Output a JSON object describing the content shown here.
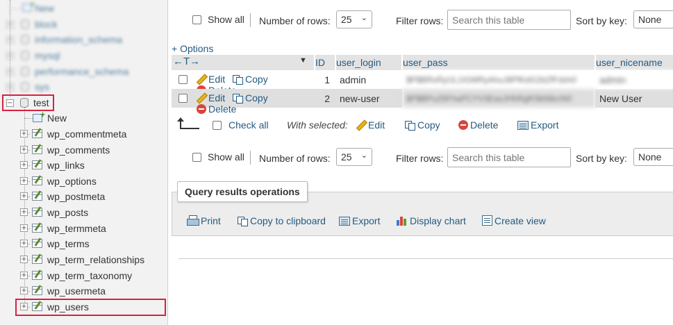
{
  "nav": {
    "blurred_items": [
      "New",
      "block",
      "information_schema",
      "mysql",
      "performance_schema",
      "sys"
    ],
    "database": "test",
    "new_label": "New",
    "tables": [
      "wp_commentmeta",
      "wp_comments",
      "wp_links",
      "wp_options",
      "wp_postmeta",
      "wp_posts",
      "wp_termmeta",
      "wp_terms",
      "wp_term_relationships",
      "wp_term_taxonomy",
      "wp_usermeta",
      "wp_users"
    ],
    "highlight_color": "#d6223f"
  },
  "controls": {
    "show_all": "Show all",
    "number_of_rows_label": "Number of rows:",
    "number_of_rows_value": "25",
    "filter_rows_label": "Filter rows:",
    "filter_placeholder": "Search this table",
    "sort_by_key_label": "Sort by key:",
    "sort_by_key_value": "None"
  },
  "options_link": "+ Options",
  "table": {
    "sort_arrows": "←T→",
    "headers": [
      "ID",
      "user_login",
      "user_pass",
      "user_nicename"
    ],
    "actions": {
      "edit": "Edit",
      "copy": "Copy",
      "delete": "Delete"
    },
    "rows": [
      {
        "id": "1",
        "user_login": "admin",
        "user_pass": "$P$BRxRyUL1IGMRyAhuJ8PfKdG2bZfFdsh0",
        "user_nicename": "admin"
      },
      {
        "id": "2",
        "user_login": "new-user",
        "user_pass": "$P$BPuZ6FhaPCYV3EasJHhRgR3bN8crN0",
        "user_nicename": "New User"
      }
    ]
  },
  "bulk": {
    "check_all": "Check all",
    "with_selected": "With selected:",
    "edit": "Edit",
    "copy": "Copy",
    "delete": "Delete",
    "export": "Export"
  },
  "query_ops": {
    "legend": "Query results operations",
    "print": "Print",
    "copy_to_clipboard": "Copy to clipboard",
    "export": "Export",
    "display_chart": "Display chart",
    "create_view": "Create view"
  }
}
